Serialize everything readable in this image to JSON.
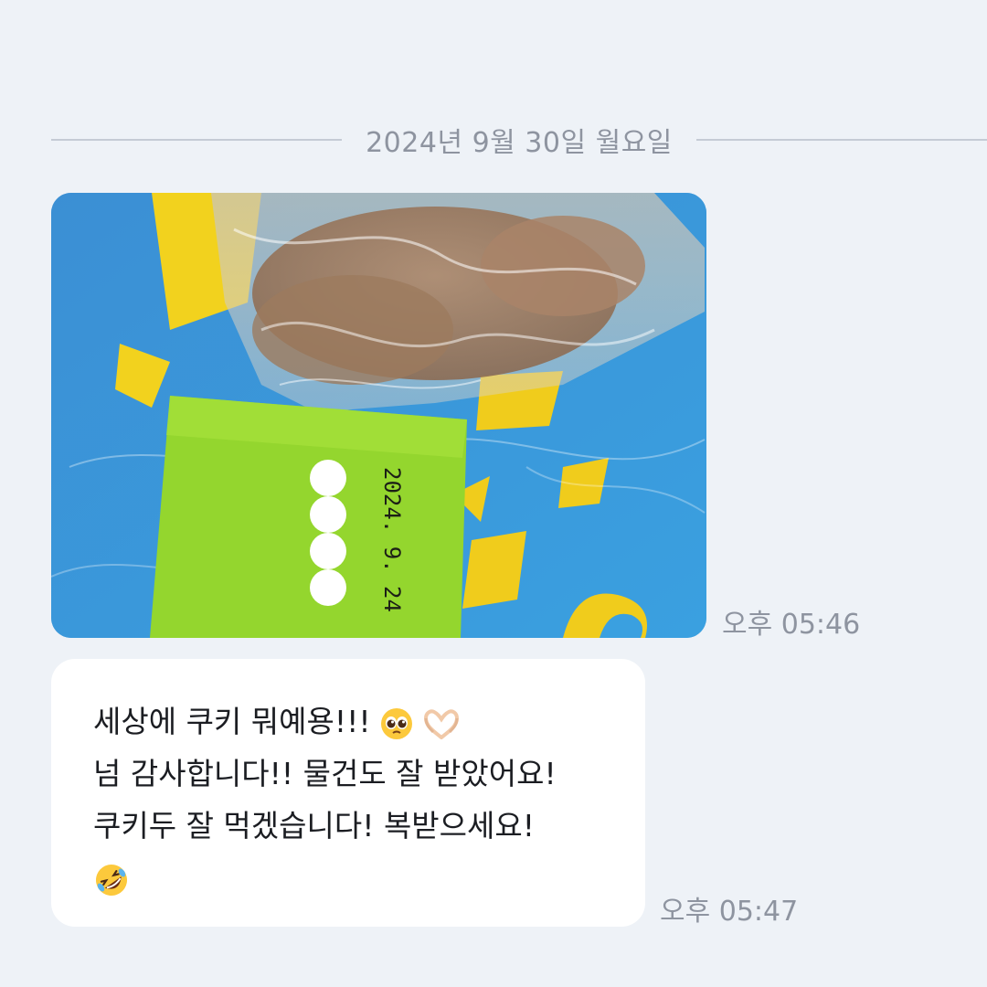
{
  "chat": {
    "date_divider": "2024년 9월 30일 월요일",
    "messages": [
      {
        "type": "image",
        "image": {
          "note_date": "2024. 9. 24"
        },
        "time": "오후 05:46"
      },
      {
        "type": "text",
        "lines": [
          "세상에 쿠키 뭐예용!!!",
          "넘 감사합니다!! 물건도 잘 받았어요!",
          "쿠키두 잘 먹겠습니다! 복받으세요!"
        ],
        "emojis": [
          "pleading-face-emoji",
          "heart-hands-emoji",
          "rolling-on-floor-laughing-emoji"
        ],
        "time": "오후 05:47"
      }
    ]
  }
}
